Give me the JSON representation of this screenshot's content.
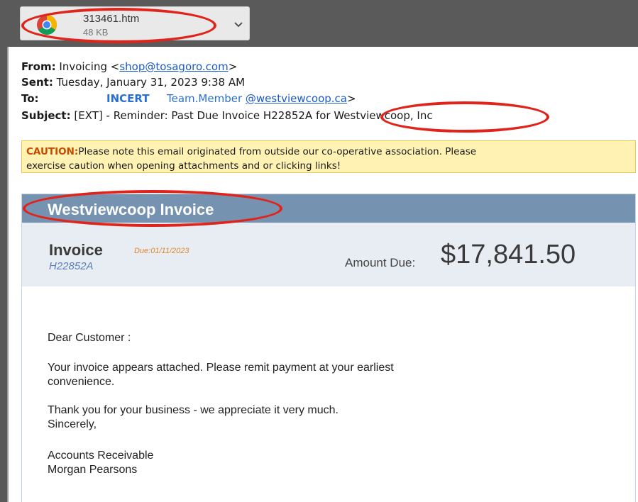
{
  "download": {
    "filename": "313461.htm",
    "size": "48 KB",
    "icon": "chrome-icon"
  },
  "email": {
    "from_label": "From:",
    "from_name": "Invoicing <",
    "from_email": "shop@tosagoro.com",
    "from_close": ">",
    "sent_label": "Sent:",
    "sent_value": "Tuesday, January 31, 2023 9:38 AM",
    "to_label": "To:",
    "to_incert": "INCERT",
    "to_name": "Team.Member",
    "to_email": "@westviewcoop.ca",
    "to_close": ">",
    "subject_label": "Subject:",
    "subject_value": "[EXT] - Reminder: Past Due Invoice H22852A for Westviewcoop, Inc"
  },
  "caution": {
    "label": "CAUTION:",
    "line1": "Please note this email originated from outside our co-operative association. Please",
    "line2": "exercise caution when opening attachments and or clicking links!"
  },
  "invoice": {
    "banner_title": "Westviewcoop Invoice",
    "label": "Invoice",
    "due": "Due:01/11/2023",
    "number": "H22852A",
    "amount_label": "Amount Due:",
    "amount": "$17,841.50"
  },
  "body": {
    "greeting": "Dear Customer :",
    "para1_line1": "Your invoice appears attached. Please remit payment at your earliest",
    "para1_line2": "convenience.",
    "para2_line1": "Thank you for your business - we appreciate it very much.",
    "para2_line2": "Sincerely,",
    "sig_line1": "Accounts Receivable",
    "sig_line2": "Morgan Pearsons"
  },
  "colors": {
    "annotation_red": "#e0241b",
    "banner": "#7592b0",
    "caution_bg": "#fff2b3",
    "link": "#1a5bc4"
  }
}
